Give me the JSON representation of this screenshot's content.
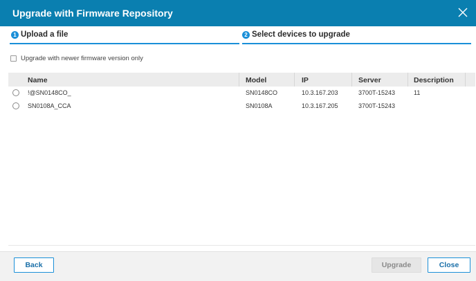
{
  "dialog": {
    "title": "Upgrade with Firmware Repository",
    "close_icon": "close-icon"
  },
  "steps": [
    {
      "number": "1",
      "label": "Upload a file"
    },
    {
      "number": "2",
      "label": "Select devices to upgrade"
    }
  ],
  "filter": {
    "label": "Upgrade with newer firmware version only",
    "checked": false
  },
  "table": {
    "columns": [
      "Name",
      "Model",
      "IP",
      "Server",
      "Description"
    ],
    "rows": [
      {
        "name": "!@SN0148CO_",
        "model": "SN0148CO",
        "ip": "10.3.167.203",
        "server": "3700T-15243",
        "description": "11"
      },
      {
        "name": "SN0108A_CCA",
        "model": "SN0108A",
        "ip": "10.3.167.205",
        "server": "3700T-15243",
        "description": ""
      }
    ]
  },
  "footer": {
    "back_label": "Back",
    "upgrade_label": "Upgrade",
    "close_label": "Close"
  },
  "colors": {
    "titlebar": "#0a7fb0",
    "accent": "#1a8fd8"
  }
}
